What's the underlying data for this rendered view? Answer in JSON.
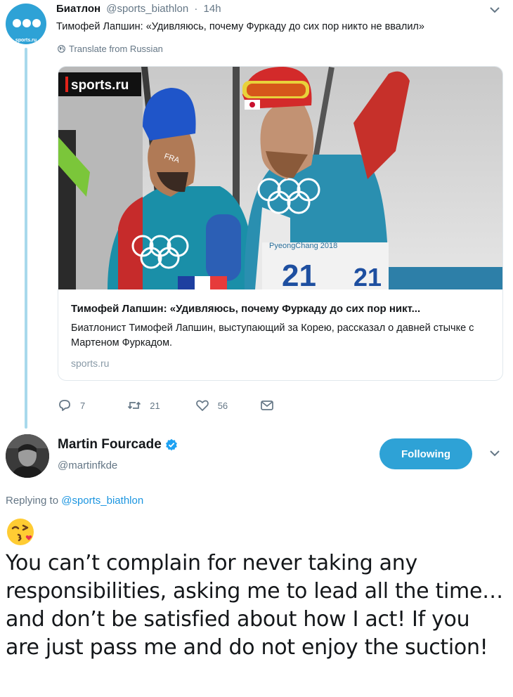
{
  "tweet1": {
    "avatar_label": "sports.ru",
    "name": "Биатлон",
    "handle": "@sports_biathlon",
    "separator": "·",
    "time": "14h",
    "text": "Тимофей Лапшин: «Удивляюсь, почему Фуркаду до сих пор никто не ввалил»",
    "translate_label": "Translate from Russian",
    "card": {
      "watermark": "sports.ru",
      "bib_text": "PyeongChang 2018",
      "bib_numbers": "21",
      "jacket_text": "FRA",
      "title": "Тимофей Лапшин: «Удивляюсь, почему Фуркаду до сих пор никт...",
      "description": "Биатлонист Тимофей Лапшин, выступающий за Корею, рассказал о давней стычке с Мартеном Фуркадом.",
      "domain": "sports.ru"
    },
    "actions": {
      "replies": "7",
      "retweets": "21",
      "likes": "56"
    }
  },
  "tweet2": {
    "name": "Martin Fourcade",
    "handle": "@martinfkde",
    "follow_label": "Following",
    "replying_prefix": "Replying to",
    "replying_handle": "@sports_biathlon",
    "text": "You can’t complain for never taking any responsibilities, asking me to lead all the time…and don’t be satisfied about how I act! If you are just pass me and do not enjoy the suction!"
  },
  "colors": {
    "accent": "#2ea2d6",
    "link": "#1b95e0",
    "muted": "#657786",
    "thread_line": "#a8d9ec"
  }
}
